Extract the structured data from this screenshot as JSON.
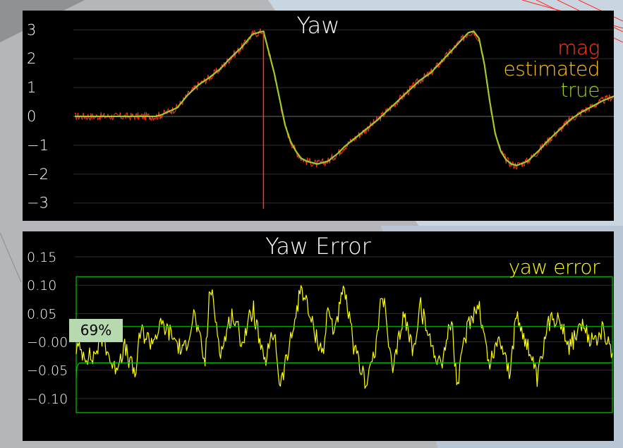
{
  "chart_data": [
    {
      "type": "line",
      "title": "Yaw",
      "ylim": [
        -3.3,
        3.3
      ],
      "y_ticks": [
        "3",
        "2",
        "1",
        "0",
        "−1",
        "−2",
        "−3"
      ],
      "y_tick_values": [
        3,
        2,
        1,
        0,
        -1,
        -2,
        -3
      ],
      "grid": true,
      "legend_position": "top-right",
      "x_range": [
        0,
        100
      ],
      "series": [
        {
          "name": "mag",
          "color": "#ff3a1a",
          "noisy": true,
          "x": [
            0,
            15,
            16,
            19,
            21,
            23,
            25,
            27,
            29,
            31,
            33,
            35,
            37,
            39,
            40,
            41,
            42,
            43,
            44,
            45,
            47,
            49,
            50,
            52,
            54,
            56,
            58,
            60,
            62,
            64,
            66,
            68,
            70,
            72,
            73,
            74,
            75,
            76,
            77,
            78,
            79,
            80,
            81,
            82,
            84,
            86,
            88,
            90,
            92,
            94,
            96,
            98,
            100
          ],
          "values": [
            0,
            0,
            0.05,
            0.3,
            0.75,
            1.1,
            1.35,
            1.65,
            2.05,
            2.4,
            2.85,
            2.95,
            1.5,
            -0.3,
            -0.85,
            -1.2,
            -1.45,
            -1.55,
            -1.6,
            -1.65,
            -1.55,
            -1.25,
            -1.05,
            -0.75,
            -0.45,
            -0.15,
            0.2,
            0.55,
            0.9,
            1.25,
            1.5,
            1.9,
            2.3,
            2.7,
            2.9,
            2.95,
            2.7,
            1.8,
            0.5,
            -0.6,
            -1.2,
            -1.5,
            -1.65,
            -1.7,
            -1.55,
            -1.2,
            -0.8,
            -0.45,
            -0.1,
            0.15,
            0.35,
            0.55,
            0.7
          ]
        },
        {
          "name": "estimated",
          "color": "#ffc21a",
          "x": [
            0,
            15,
            16,
            19,
            21,
            23,
            25,
            27,
            29,
            31,
            33,
            35,
            37,
            39,
            40,
            41,
            42,
            43,
            44,
            45,
            47,
            49,
            50,
            52,
            54,
            56,
            58,
            60,
            62,
            64,
            66,
            68,
            70,
            72,
            73,
            74,
            75,
            76,
            77,
            78,
            79,
            80,
            81,
            82,
            84,
            86,
            88,
            90,
            92,
            94,
            96,
            98,
            100
          ],
          "values": [
            0,
            0,
            0.05,
            0.3,
            0.75,
            1.1,
            1.35,
            1.65,
            2.05,
            2.4,
            2.85,
            2.95,
            1.5,
            -0.3,
            -0.85,
            -1.2,
            -1.45,
            -1.55,
            -1.6,
            -1.65,
            -1.55,
            -1.25,
            -1.05,
            -0.75,
            -0.45,
            -0.15,
            0.2,
            0.55,
            0.9,
            1.25,
            1.5,
            1.9,
            2.3,
            2.7,
            2.9,
            2.95,
            2.7,
            1.8,
            0.5,
            -0.6,
            -1.2,
            -1.5,
            -1.65,
            -1.7,
            -1.55,
            -1.2,
            -0.8,
            -0.45,
            -0.1,
            0.15,
            0.35,
            0.55,
            0.7
          ]
        },
        {
          "name": "true",
          "color": "#9ccc2a",
          "x": [
            0,
            15,
            16,
            19,
            21,
            23,
            25,
            27,
            29,
            31,
            33,
            35,
            37,
            39,
            40,
            41,
            42,
            43,
            44,
            45,
            47,
            49,
            50,
            52,
            54,
            56,
            58,
            60,
            62,
            64,
            66,
            68,
            70,
            72,
            73,
            74,
            75,
            76,
            77,
            78,
            79,
            80,
            81,
            82,
            84,
            86,
            88,
            90,
            92,
            94,
            96,
            98,
            100
          ],
          "values": [
            0,
            0,
            0.05,
            0.3,
            0.75,
            1.1,
            1.35,
            1.65,
            2.05,
            2.4,
            2.85,
            2.95,
            1.5,
            -0.3,
            -0.85,
            -1.2,
            -1.45,
            -1.55,
            -1.6,
            -1.65,
            -1.55,
            -1.25,
            -1.05,
            -0.75,
            -0.45,
            -0.15,
            0.2,
            0.55,
            0.9,
            1.25,
            1.5,
            1.9,
            2.3,
            2.7,
            2.9,
            2.95,
            2.7,
            1.8,
            0.5,
            -0.6,
            -1.2,
            -1.5,
            -1.65,
            -1.7,
            -1.55,
            -1.2,
            -0.8,
            -0.45,
            -0.1,
            0.15,
            0.35,
            0.55,
            0.7
          ]
        }
      ],
      "annotation": {
        "type": "vertical-line",
        "x": 35,
        "from": 2.9,
        "to": -3.2,
        "color": "#ff3a1a"
      }
    },
    {
      "type": "line",
      "title": "Yaw Error",
      "ylim": [
        -0.16,
        0.17
      ],
      "y_ticks": [
        "0.15",
        "0.10",
        "0.05",
        "−0.00",
        "−0.05",
        "−0.10"
      ],
      "y_tick_values": [
        0.15,
        0.1,
        0.05,
        0.0,
        -0.05,
        -0.1
      ],
      "grid": true,
      "legend_position": "top-right",
      "x_range": [
        0,
        100
      ],
      "series": [
        {
          "name": "yaw error",
          "color": "#ffff00",
          "x": [
            0,
            3,
            5,
            7,
            9,
            11,
            12,
            14,
            16,
            18,
            20,
            22,
            24,
            25,
            26,
            27,
            29,
            31,
            33,
            35,
            37,
            38,
            40,
            42,
            44,
            46,
            47,
            48,
            50,
            52,
            54,
            56,
            57,
            59,
            61,
            63,
            64,
            66,
            68,
            70,
            71,
            73,
            75,
            77,
            79,
            81,
            82,
            84,
            86,
            88,
            90,
            92,
            94,
            96,
            98,
            100
          ],
          "values": [
            -0.01,
            -0.03,
            0.01,
            -0.05,
            -0.01,
            -0.06,
            0.02,
            0.0,
            0.03,
            0.01,
            -0.02,
            0.05,
            -0.04,
            0.1,
            0.04,
            -0.02,
            0.05,
            0.0,
            0.06,
            -0.04,
            0.02,
            -0.08,
            0.0,
            0.1,
            0.03,
            -0.02,
            0.06,
            0.02,
            0.09,
            -0.02,
            -0.07,
            -0.01,
            0.1,
            -0.06,
            0.05,
            -0.02,
            0.07,
            0.0,
            -0.04,
            0.04,
            -0.08,
            0.03,
            0.07,
            -0.04,
            0.01,
            -0.06,
            0.05,
            0.0,
            -0.07,
            0.03,
            0.05,
            -0.01,
            0.03,
            0.0,
            0.02,
            -0.02
          ]
        }
      ],
      "threshold_box": {
        "x_from": 0,
        "x_to": 100,
        "y_from": -0.125,
        "y_to": 0.115,
        "color": "#00c800"
      },
      "threshold_lines": [
        0.027,
        -0.037
      ],
      "threshold_start_y": -0.065,
      "threshold_ramp_end_x": 0.8,
      "badge": "69%"
    }
  ]
}
